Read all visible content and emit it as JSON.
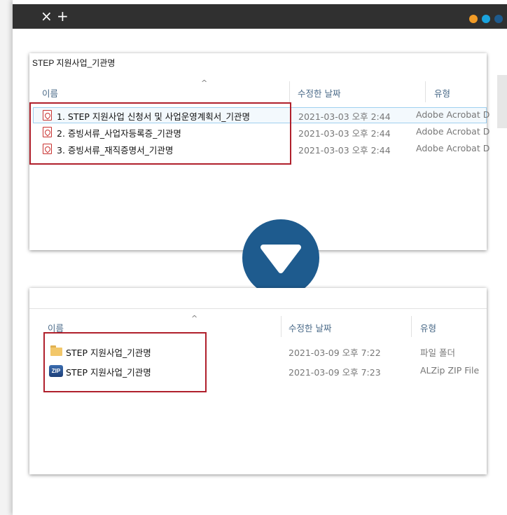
{
  "window": {
    "close_glyph": "×",
    "new_tab_glyph": "+",
    "dots": [
      "#f29b26",
      "#1aa3de",
      "#1e5b8e"
    ]
  },
  "explorer_before": {
    "path": "STEP 지원사업_기관명",
    "columns": {
      "name": "이름",
      "date": "수정한 날짜",
      "type": "유형"
    },
    "sort_indicator": "^",
    "files": [
      {
        "icon": "pdf-icon",
        "name": "1. STEP 지원사업 신청서 및 사업운영계획서_기관명",
        "date": "2021-03-03 오후 2:44",
        "type": "Adobe Acrobat D"
      },
      {
        "icon": "pdf-icon",
        "name": "2. 증빙서류_사업자등록증_기관명",
        "date": "2021-03-03 오후 2:44",
        "type": "Adobe Acrobat D"
      },
      {
        "icon": "pdf-icon",
        "name": "3. 증빙서류_재직증명서_기관명",
        "date": "2021-03-03 오후 2:44",
        "type": "Adobe Acrobat D"
      }
    ]
  },
  "explorer_after": {
    "columns": {
      "name": "이름",
      "date": "수정한 날짜",
      "type": "유형"
    },
    "sort_indicator": "^",
    "files": [
      {
        "icon": "folder-icon",
        "name": "STEP 지원사업_기관명",
        "date": "2021-03-09 오후 7:22",
        "type": "파일 폴더"
      },
      {
        "icon": "zip-icon",
        "icon_label": "ZIP",
        "name": "STEP 지원사업_기관명",
        "date": "2021-03-09 오후 7:23",
        "type": "ALZip ZIP File"
      }
    ]
  },
  "arrow_icon": "down-arrow-icon",
  "colors": {
    "highlight": "#b0202c",
    "accent": "#1e5b8e",
    "titlebar": "#303030"
  }
}
